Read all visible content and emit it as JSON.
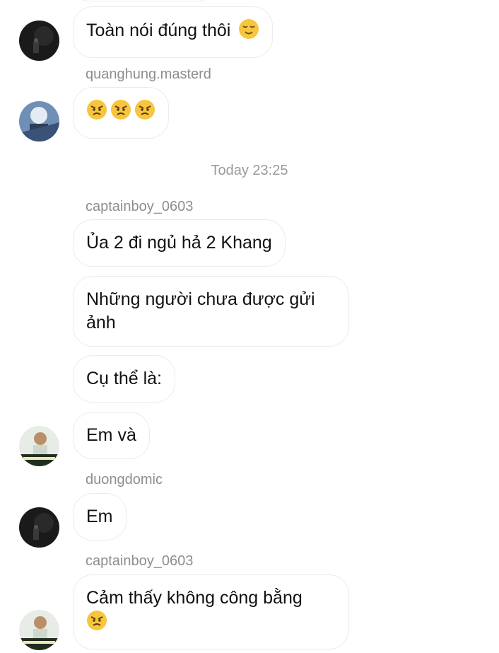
{
  "messages": [
    {
      "text": "Toàn nói đúng thôi",
      "emoji": "relieved-face"
    },
    {
      "username": "quanghung.masterd",
      "emoji": [
        "angry-face",
        "angry-face",
        "angry-face"
      ]
    },
    {
      "timestamp": "Today 23:25"
    },
    {
      "username": "captainboy_0603",
      "texts": [
        "Ủa 2 đi ngủ hả 2 Khang",
        "Những người chưa được gửi ảnh",
        "Cụ thể là:",
        "Em và"
      ]
    },
    {
      "username": "duongdomic",
      "text": "Em"
    },
    {
      "username": "captainboy_0603",
      "text": "Cảm thấy không công bằng",
      "emoji": "angry-face"
    }
  ],
  "colors": {
    "bubble_border": "#ebebeb",
    "username": "#8e8e8e",
    "timestamp": "#9a9a9a",
    "emoji_face": "#f7c63d"
  }
}
